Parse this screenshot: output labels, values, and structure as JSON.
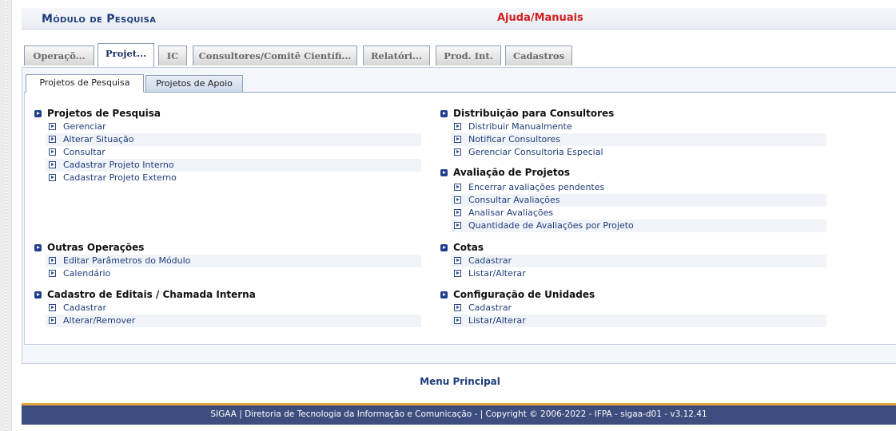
{
  "header": {
    "title": "Módulo de Pesquisa",
    "help_link": "Ajuda/Manuais"
  },
  "tabs": [
    {
      "label": "Operaçõ..."
    },
    {
      "label": "Projet..."
    },
    {
      "label": "IC"
    },
    {
      "label": "Consultores/Comitê Científi..."
    },
    {
      "label": "Relatóri..."
    },
    {
      "label": "Prod. Int."
    },
    {
      "label": "Cadastros"
    }
  ],
  "subtabs": [
    {
      "label": "Projetos de Pesquisa"
    },
    {
      "label": "Projetos de Apoio"
    }
  ],
  "left": {
    "projetos": {
      "title": "Projetos de Pesquisa",
      "items": [
        "Gerenciar",
        "Alterar Situação",
        "Consultar",
        "Cadastrar Projeto Interno",
        "Cadastrar Projeto Externo"
      ]
    },
    "outras": {
      "title": "Outras Operações",
      "items": [
        "Editar Parâmetros do Módulo",
        "Calendário"
      ]
    },
    "editais": {
      "title": "Cadastro de Editais / Chamada Interna",
      "items": [
        "Cadastrar",
        "Alterar/Remover"
      ]
    }
  },
  "right": {
    "distribuicao": {
      "title": "Distribuição para Consultores",
      "items": [
        "Distribuir Manualmente",
        "Notificar Consultores",
        "Gerenciar Consultoria Especial"
      ]
    },
    "avaliacao": {
      "title": "Avaliação de Projetos",
      "items": [
        "Encerrar avaliações pendentes",
        "Consultar Avaliações",
        "Analisar Avaliações",
        "Quantidade de Avaliações por Projeto"
      ]
    },
    "cotas": {
      "title": "Cotas",
      "items": [
        "Cadastrar",
        "Listar/Alterar"
      ]
    },
    "unidades": {
      "title": "Configuração de Unidades",
      "items": [
        "Cadastrar",
        "Listar/Alterar"
      ]
    }
  },
  "menu_principal": "Menu Principal",
  "footer": "SIGAA | Diretoria de Tecnologia da Informação e Comunicação - | Copyright © 2006-2022 - IFPA - sigaa-d01 - v3.12.41",
  "colors": {
    "accent": "#1f3d7a",
    "help": "#d11f1f",
    "footer_bg": "#3d4d7e",
    "footer_border": "#e6a53c"
  }
}
